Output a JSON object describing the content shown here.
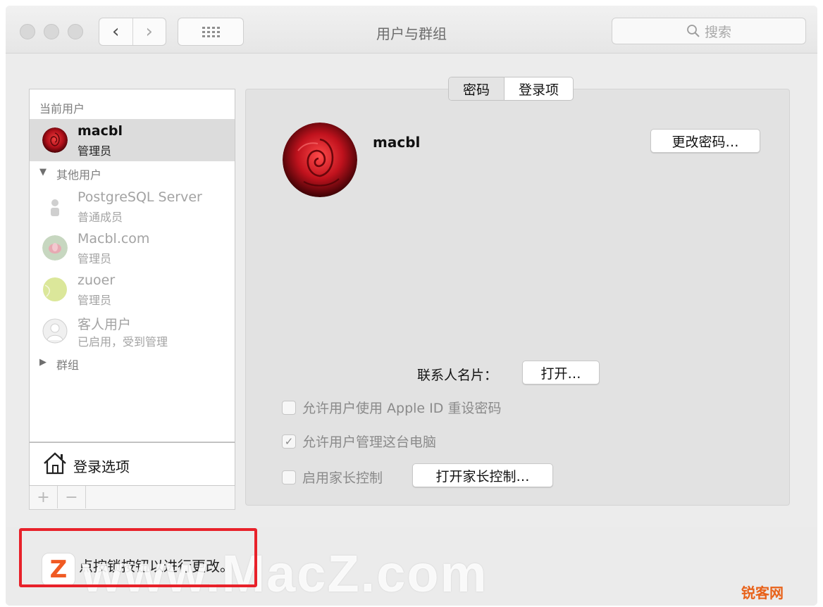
{
  "window": {
    "title": "用户与群组",
    "search_placeholder": "搜索"
  },
  "sidebar": {
    "current_users_label": "当前用户",
    "current_user": {
      "name": "macbl",
      "role": "管理员"
    },
    "other_users_label": "其他用户",
    "other_users": [
      {
        "name": "PostgreSQL Server",
        "role": "普通成员"
      },
      {
        "name": "Macbl.com",
        "role": "管理员"
      },
      {
        "name": "zuoer",
        "role": "管理员"
      },
      {
        "name": "客人用户",
        "role": "已启用，受到管理"
      }
    ],
    "groups_label": "群组",
    "login_options_label": "登录选项",
    "add_label": "+",
    "remove_label": "−"
  },
  "main": {
    "tabs": [
      {
        "label": "密码"
      },
      {
        "label": "登录项"
      }
    ],
    "user_name": "macbl",
    "change_password_label": "更改密码…",
    "contact_card_label": "联系人名片：",
    "open_label": "打开…",
    "checkboxes": [
      {
        "label": "允许用户使用 Apple ID 重设密码",
        "checked": false
      },
      {
        "label": "允许用户管理这台电脑",
        "checked": true
      },
      {
        "label": "启用家长控制",
        "checked": false
      }
    ],
    "open_parental_label": "打开家长控制…"
  },
  "bottom": {
    "lock_text": "点按锁按钮以进行更改。",
    "watermark": "www.MacZ.com",
    "logo_letter": "Z",
    "corner_mark": "锐客网"
  },
  "colors": {
    "highlight": "#e8212a",
    "watermark_logo": "#f05a23",
    "corner_mark": "#e8621a"
  }
}
